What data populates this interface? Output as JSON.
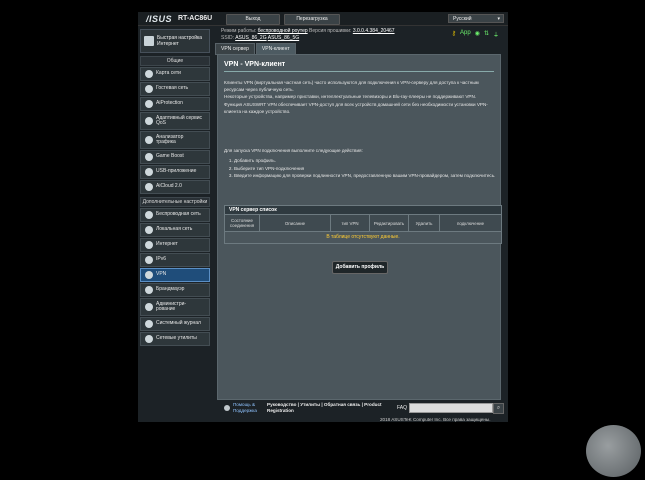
{
  "header": {
    "logo": "/ISUS",
    "model": "RT-AC86U",
    "logout_label": "Выход",
    "reboot_label": "Перезагрузка",
    "language": "Русский"
  },
  "status": {
    "mode_label": "Режим работы:",
    "mode_value": "беспроводной роутер",
    "fw_label": "Версия прошивки:",
    "fw_value": "3.0.0.4.384_20467",
    "ssid_label": "SSID:",
    "ssid_1": "ASUS_86_2G",
    "ssid_2": "ASUS_86_5G",
    "app_label": "App"
  },
  "sidebar": {
    "quick_setup": [
      "Быстрая настройка",
      "Интернет"
    ],
    "general_header": "Общие",
    "general_items": [
      {
        "label": [
          "Карта сети"
        ]
      },
      {
        "label": [
          "Гостевая сеть"
        ]
      },
      {
        "label": [
          "AiProtection"
        ]
      },
      {
        "label": [
          "Адаптивный сервис",
          "QoS"
        ]
      },
      {
        "label": [
          "Анализатор",
          "трафика"
        ]
      },
      {
        "label": [
          "Game Boost"
        ]
      },
      {
        "label": [
          "USB-приложение"
        ]
      },
      {
        "label": [
          "AiCloud 2.0"
        ]
      }
    ],
    "advanced_header": "Дополнительные настройки",
    "advanced_items": [
      {
        "label": [
          "Беспроводная сеть"
        ]
      },
      {
        "label": [
          "Локальная сеть"
        ]
      },
      {
        "label": [
          "Интернет"
        ]
      },
      {
        "label": [
          "IPv6"
        ]
      },
      {
        "label": [
          "VPN"
        ]
      },
      {
        "label": [
          "Брандмауэр"
        ]
      },
      {
        "label": [
          "Администри-",
          "рование"
        ]
      },
      {
        "label": [
          "Системный журнал"
        ]
      },
      {
        "label": [
          "Сетевые утилиты"
        ]
      }
    ],
    "active": "VPN"
  },
  "tabs": [
    "VPN сервер",
    "VPN-клиент"
  ],
  "content": {
    "title": "VPN - VPN-клиент",
    "desc": [
      "Клиенты VPN (виртуальная частная сеть) часто используются для подключения к VPN-серверу для доступа к частным",
      "ресурсам через публичную сеть.",
      "Некоторые устройства, например приставки, интеллектуальные телевизоры и Blu-ray-плееры не поддерживают VPN.",
      "Функция ASUSWRT VPN обеспечивает VPN-доступ для всех устройств домашней сети без необходимости установки VPN-",
      "клиента на каждое устройство."
    ],
    "steps_header": "Для запуска VPN подключения выполните следующие действия:",
    "steps": [
      "Добавить профиль.",
      "Выберите тип VPN-подключения",
      "Введите информацию для проверки подлинности VPN, предоставленную вашим VPN-провайдером, затем подключитесь."
    ],
    "table": {
      "caption": "VPN сервер список",
      "columns": [
        "Состояние соединения",
        "Описание",
        "тип VPN",
        "Редактировать",
        "Удалить",
        "подключение"
      ],
      "empty": "В таблице отсутствуют данные."
    },
    "add_button": "Добавить профиль"
  },
  "footer": {
    "help": [
      "Помощь &",
      "Поддержка"
    ],
    "links_1": "Руководство | Утилиты | Обратная связь | Product",
    "links_2": "Registration",
    "faq": "FAQ",
    "copyright": "2018 ASUSTeK Computer Inc. Все права защищены."
  }
}
